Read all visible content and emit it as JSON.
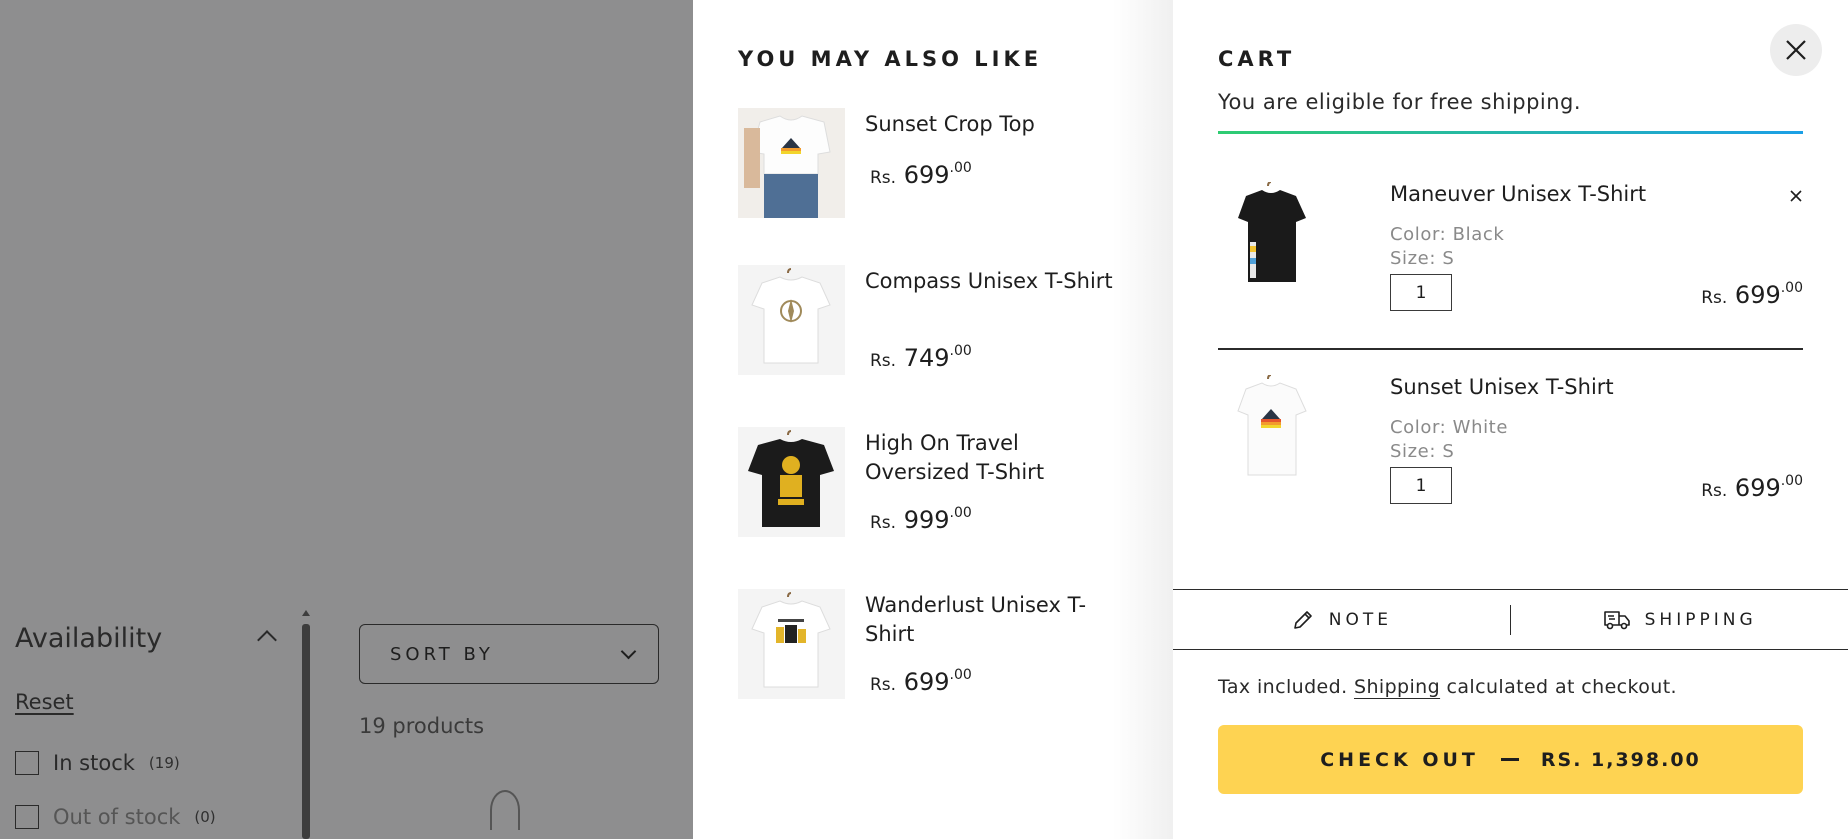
{
  "background": {
    "filter_title": "Availability",
    "reset_label": "Reset",
    "filters": [
      {
        "label": "In stock",
        "count": "(19)"
      },
      {
        "label": "Out of stock",
        "count": "(0)"
      }
    ],
    "sort_label": "SORT BY",
    "product_count": "19 products"
  },
  "recommendations": {
    "title": "YOU MAY ALSO LIKE",
    "items": [
      {
        "name": "Sunset Crop Top",
        "currency": "Rs.",
        "price": "699",
        "cents": ".00"
      },
      {
        "name": "Compass Unisex T-Shirt",
        "currency": "Rs.",
        "price": "749",
        "cents": ".00"
      },
      {
        "name": "High On Travel Oversized T-Shirt",
        "currency": "Rs.",
        "price": "999",
        "cents": ".00"
      },
      {
        "name": "Wanderlust Unisex T-Shirt",
        "currency": "Rs.",
        "price": "699",
        "cents": ".00"
      }
    ]
  },
  "cart": {
    "title": "CART",
    "free_shipping": "You are eligible for free shipping.",
    "items": [
      {
        "name": "Maneuver Unisex T-Shirt",
        "color": "Color: Black",
        "size": "Size: S",
        "qty": "1",
        "currency": "Rs.",
        "price": "699",
        "cents": ".00"
      },
      {
        "name": "Sunset Unisex T-Shirt",
        "color": "Color: White",
        "size": "Size: S",
        "qty": "1",
        "currency": "Rs.",
        "price": "699",
        "cents": ".00"
      }
    ],
    "note_label": "NOTE",
    "shipping_label": "SHIPPING",
    "tax_prefix": "Tax included.",
    "tax_link": "Shipping",
    "tax_suffix": "calculated at checkout.",
    "checkout_label": "CHECK OUT",
    "checkout_amount": "RS. 1,398.00",
    "icons": [
      "close-icon",
      "pencil-icon",
      "truck-icon",
      "remove-icon"
    ],
    "accent_color": "#fed352"
  }
}
